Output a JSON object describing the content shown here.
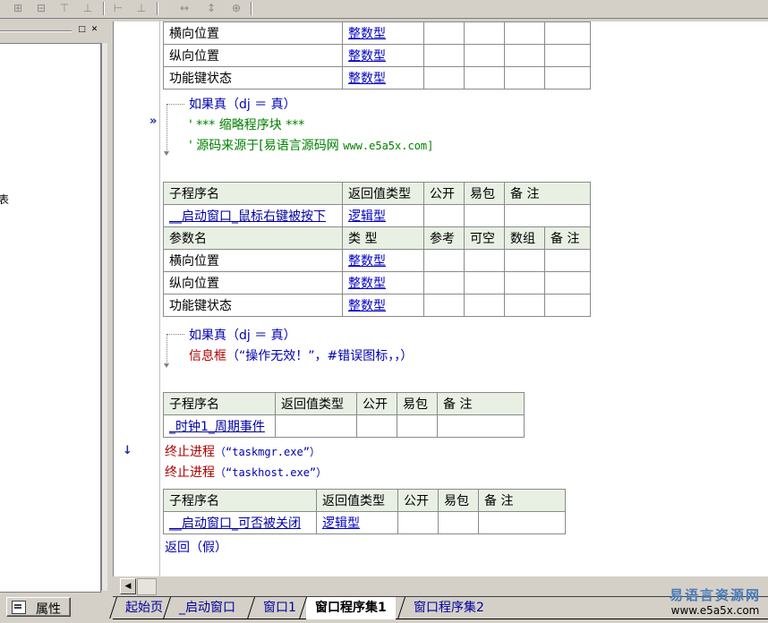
{
  "left_panel": {
    "stub_text": "表",
    "property_tab_label": "属性"
  },
  "editor": {
    "table1_rows": [
      {
        "name": "横向位置",
        "type": "整数型"
      },
      {
        "name": "纵向位置",
        "type": "整数型"
      },
      {
        "name": "功能键状态",
        "type": "整数型"
      }
    ],
    "block1": {
      "if_line": "如果真（dj ＝ 真）",
      "comment1": "' *** 缩略程序块 ***",
      "comment2_prefix": "' 源码来源于[易语言源码网 ",
      "comment2_url": "www.e5a5x.com]"
    },
    "sub2": {
      "headers": [
        "子程序名",
        "返回值类型",
        "公开",
        "易包",
        "备 注"
      ],
      "name": "__启动窗口_鼠标右键被按下",
      "return_type": "逻辑型",
      "param_headers": [
        "参数名",
        "类 型",
        "参考",
        "可空",
        "数组",
        "备 注"
      ],
      "params": [
        {
          "name": "横向位置",
          "type": "整数型"
        },
        {
          "name": "纵向位置",
          "type": "整数型"
        },
        {
          "name": "功能键状态",
          "type": "整数型"
        }
      ]
    },
    "block2": {
      "if_line": "如果真（dj ＝ 真）",
      "msg_func": "信息框",
      "msg_args": "（“操作无效！”，#错误图标，，）"
    },
    "sub3": {
      "headers": [
        "子程序名",
        "返回值类型",
        "公开",
        "易包",
        "备 注"
      ],
      "name": "_时钟1_周期事件"
    },
    "kill1_func": "终止进程",
    "kill1_args": "（“taskmgr.exe”）",
    "kill2_func": "终止进程",
    "kill2_args": "（“taskhost.exe”）",
    "sub4": {
      "headers": [
        "子程序名",
        "返回值类型",
        "公开",
        "易包",
        "备 注"
      ],
      "name": "__启动窗口_可否被关闭",
      "return_type": "逻辑型"
    },
    "return_line": "返回（假）"
  },
  "tabs": [
    "起始页",
    "_启动窗口",
    "窗口1",
    "窗口程序集1",
    "窗口程序集2"
  ],
  "active_tab": 3,
  "watermark": {
    "top": "易语言资源网",
    "bottom": "www.e5a5x.com"
  },
  "colors": {
    "type_link": "#0000c8",
    "keyword": "#0000b0",
    "command": "#b00000",
    "comment": "#008000",
    "table_header": "#e8f0e4"
  }
}
